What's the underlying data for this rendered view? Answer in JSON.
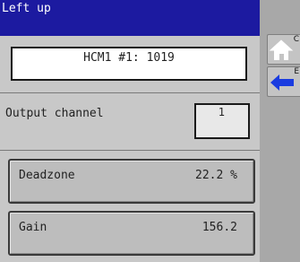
{
  "header": {
    "title": "Left up"
  },
  "device": {
    "label": "HCM1 #1: 1019"
  },
  "output_channel": {
    "label": "Output channel",
    "value": "1"
  },
  "params": [
    {
      "label": "Deadzone",
      "value": "22.2 %"
    },
    {
      "label": "Gain",
      "value": "156.2"
    }
  ],
  "side_buttons": [
    {
      "icon": "home-icon",
      "letter": "C"
    },
    {
      "icon": "back-arrow-icon",
      "letter": "E"
    }
  ],
  "colors": {
    "header": "#1c1aa0",
    "arrow": "#1a3ce0",
    "background": "#c8c8c8"
  }
}
